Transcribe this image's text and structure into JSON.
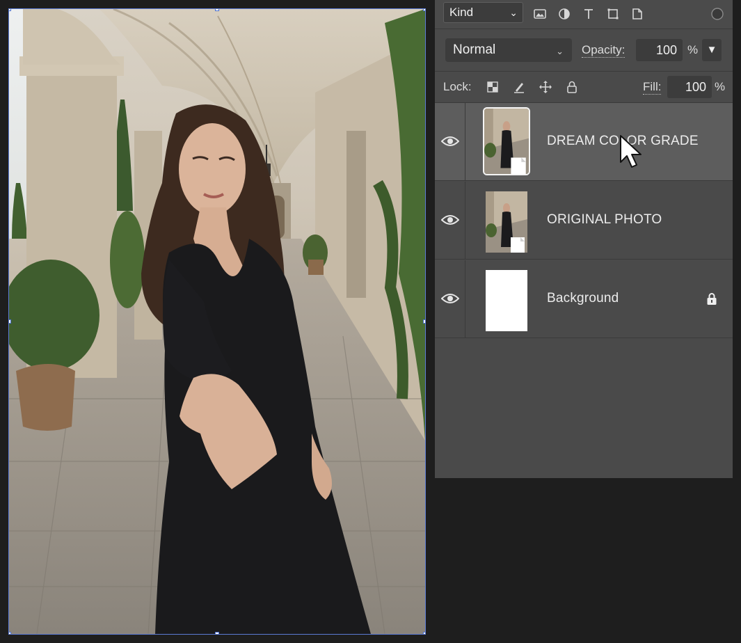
{
  "canvas": {
    "image": "photo-woman-black-dress-arcade-corridor"
  },
  "layers_panel": {
    "filter": {
      "kind_label": "Kind",
      "icons": [
        "image-filter-icon",
        "adjustment-filter-icon",
        "type-filter-icon",
        "shape-filter-icon",
        "smart-object-filter-icon",
        "filter-toggle-icon"
      ]
    },
    "blend": {
      "mode": "Normal",
      "opacity_label": "Opacity:",
      "opacity_value": "100",
      "opacity_unit": "%"
    },
    "lock_row": {
      "lock_label": "Lock:",
      "icons": [
        "lock-transparent-pixels-icon",
        "lock-image-pixels-icon",
        "lock-position-icon",
        "lock-all-icon"
      ],
      "fill_label": "Fill:",
      "fill_value": "100",
      "fill_unit": "%"
    },
    "layers": [
      {
        "name": "DREAM COLOR GRADE",
        "visible": true,
        "selected": true,
        "locked": false
      },
      {
        "name": "ORIGINAL PHOTO",
        "visible": true,
        "selected": false,
        "locked": false
      },
      {
        "name": "Background",
        "visible": true,
        "selected": false,
        "locked": true
      }
    ]
  },
  "colors": {
    "app_bg": "#1e1e1e",
    "panel_bg": "#4a4a4a",
    "selected_row": "#5d5d5d",
    "field_bg": "#3c3c3c",
    "selection_outline": "#5b7bd5"
  }
}
